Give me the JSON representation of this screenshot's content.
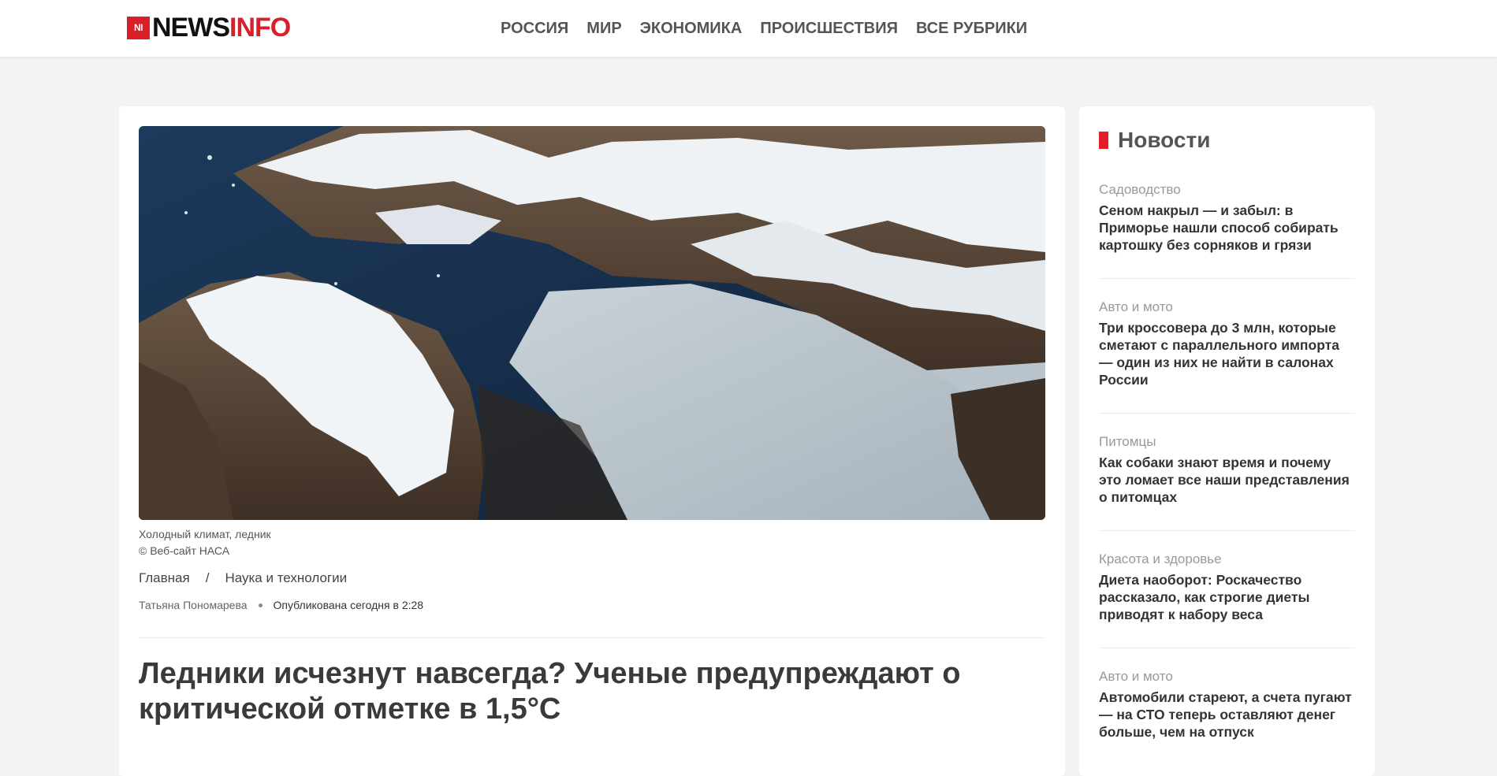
{
  "header": {
    "logo_badge": "NI",
    "logo_news": "NEWS",
    "logo_info": "INFO",
    "nav": [
      "РОССИЯ",
      "МИР",
      "ЭКОНОМИКА",
      "ПРОИСШЕСТВИЯ",
      "ВСЕ РУБРИКИ"
    ]
  },
  "article": {
    "caption_line1": "Холодный климат, ледник",
    "caption_line2": "© Веб-сайт НАСА",
    "breadcrumb": [
      "Главная",
      "Наука и технологии"
    ],
    "breadcrumb_sep": "/",
    "author": "Татьяна Пономарева",
    "published": "Опубликована сегодня в 2:28",
    "headline": "Ледники исчезнут навсегда? Ученые предупреждают о критической отметке в 1,5°C"
  },
  "sidebar": {
    "title": "Новости",
    "items": [
      {
        "category": "Садоводство",
        "headline": "Сеном накрыл — и забыл: в Приморье нашли способ собирать картошку без сорняков и грязи"
      },
      {
        "category": "Авто и мото",
        "headline": "Три кроссовера до 3 млн, которые сметают с параллельного импорта — один из них не найти в салонах России"
      },
      {
        "category": "Питомцы",
        "headline": "Как собаки знают время и почему это ломает все наши представления о питомцах"
      },
      {
        "category": "Красота и здоровье",
        "headline": "Диета наоборот: Роскачество рассказало, как строгие диеты приводят к набору веса"
      },
      {
        "category": "Авто и мото",
        "headline": "Автомобили стареют, а счета пугают — на СТО теперь оставляют денег больше, чем на отпуск"
      }
    ]
  },
  "colors": {
    "accent": "#d9202a",
    "background": "#f2f3f5"
  }
}
